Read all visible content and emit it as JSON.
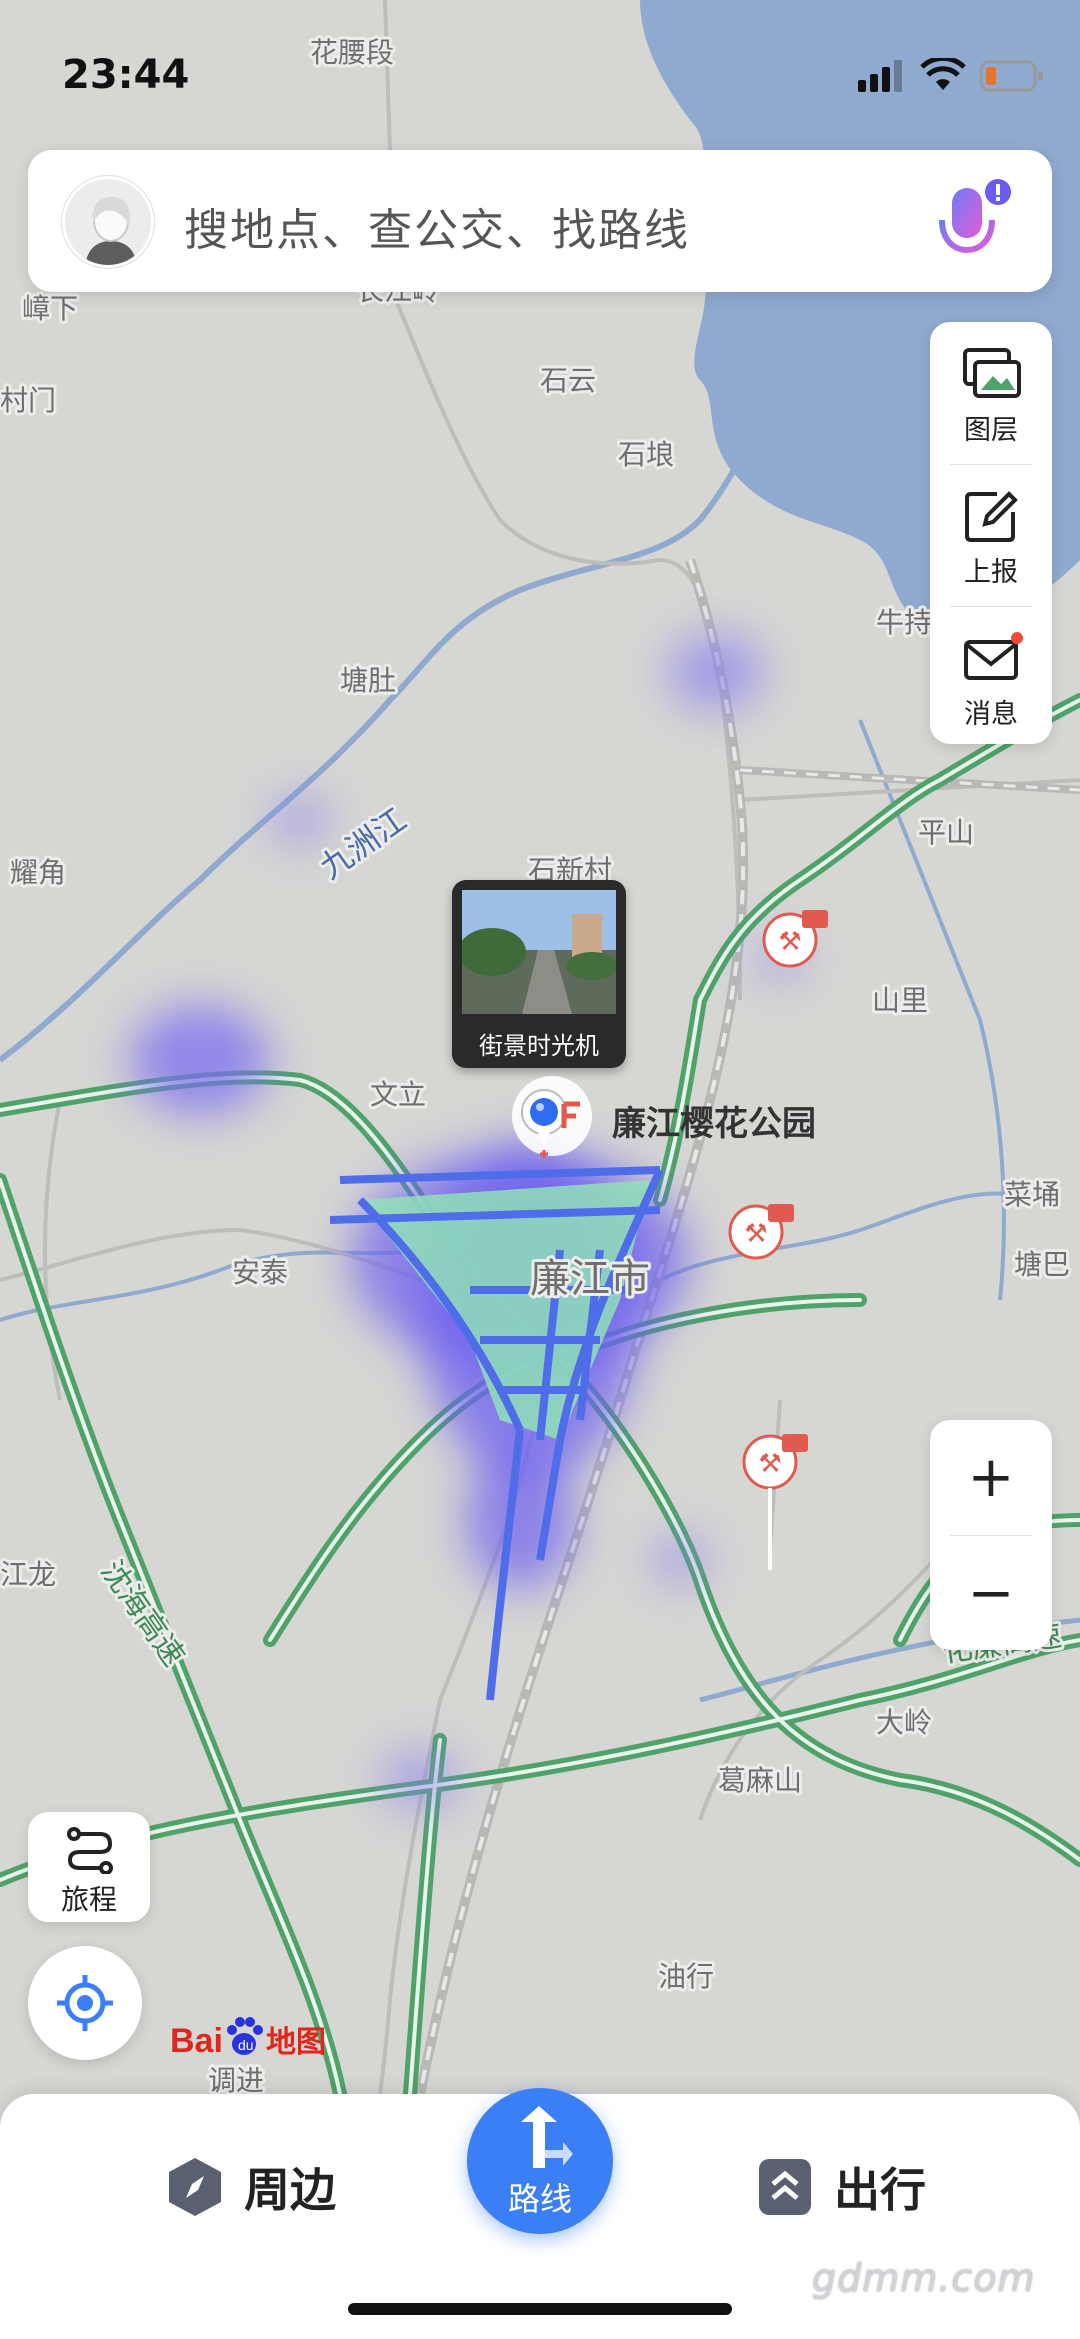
{
  "status_bar": {
    "time": "23:44"
  },
  "search": {
    "placeholder": "搜地点、查公交、找路线"
  },
  "side_panel": {
    "layers_label": "图层",
    "report_label": "上报",
    "messages_label": "消息"
  },
  "zoom": {
    "in": "+",
    "out": "−"
  },
  "trip_button": {
    "label": "旅程"
  },
  "poi": {
    "name": "廉江樱花公园"
  },
  "street_view": {
    "label": "街景时光机"
  },
  "map_labels": {
    "huayaoduan": "花腰段",
    "zhangxia": "嶂下",
    "changjiangling": "长江岭",
    "shiyun": "石云",
    "shilang": "石埌",
    "tangdu": "塘肚",
    "jiuzhoujiang": "九洲江",
    "yaojiao": "耀角",
    "shixincun": "石新村",
    "pingshan": "平山",
    "shanli": "山里",
    "wenli": "文立",
    "antai": "安泰",
    "lianjiangshi": "廉江市",
    "caipu": "菜埇",
    "tangba": "塘巴",
    "jianglong": "江龙",
    "daling": "大岭",
    "gemashan": "葛麻山",
    "youxing": "油行",
    "tiaojin": "调进",
    "niute": "牛持",
    "hunmen": "村门",
    "hhj": "沈海高速",
    "huahu": "化廉高速"
  },
  "bottom_bar": {
    "nearby": "周边",
    "route": "路线",
    "travel": "出行"
  },
  "logo": {
    "text": "Baidu地图"
  },
  "watermark": "gdmm.com",
  "colors": {
    "accent": "#3b7ff7",
    "water": "#8fa9cf",
    "highway": "#4fa36a",
    "heat": "#7b6cf0"
  }
}
